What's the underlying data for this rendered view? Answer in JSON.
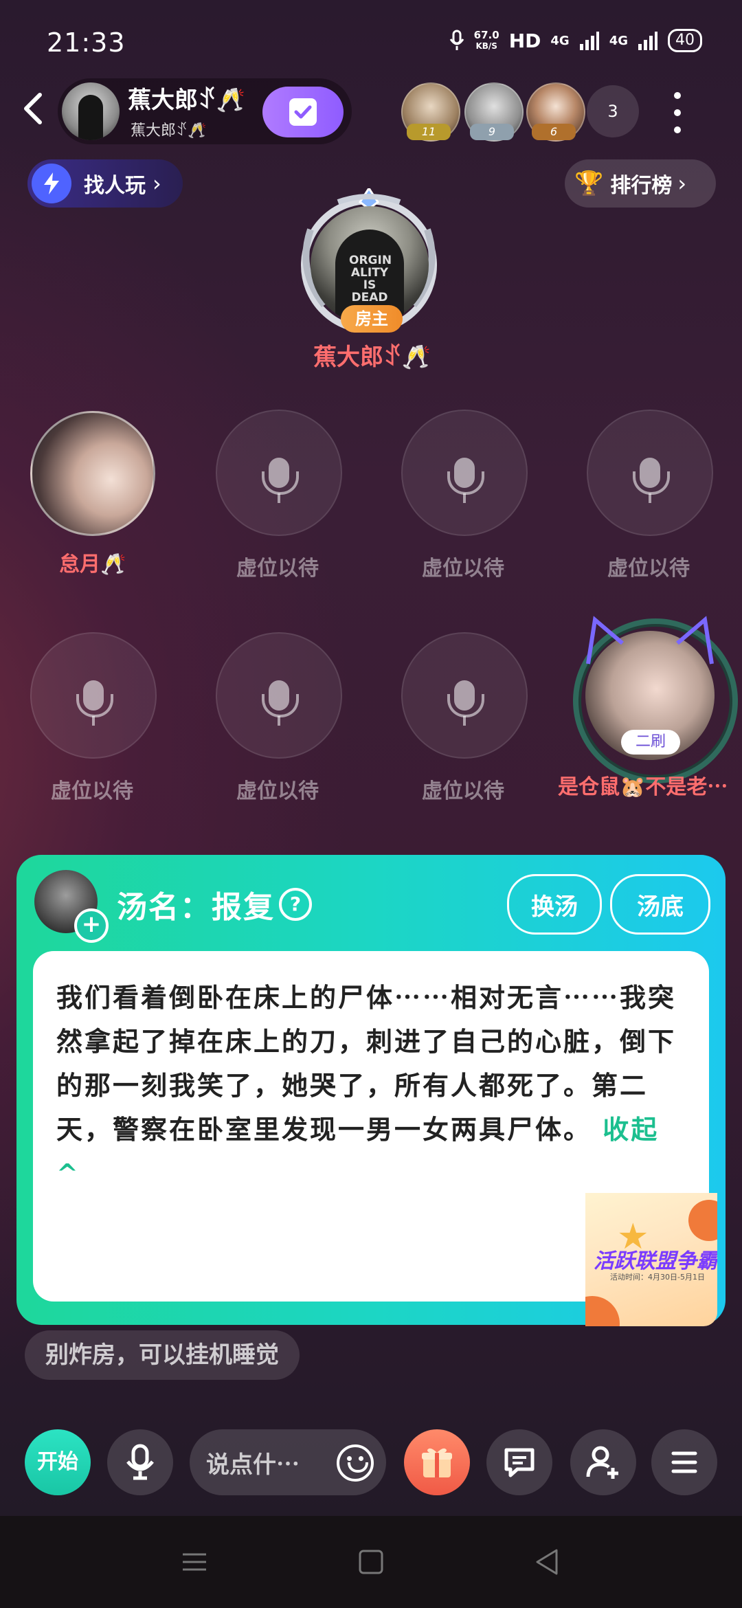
{
  "status_bar": {
    "time": "21:33",
    "net_speed": "67.0",
    "net_unit": "KB/S",
    "hd": "HD",
    "signal1": "4G",
    "signal2": "4G",
    "battery": "40"
  },
  "header": {
    "host_name": "蕉大郎ꀋ🥂",
    "host_sub": "蕉大郎ꀋ🥂",
    "audience_badges": [
      "11",
      "9",
      "6"
    ],
    "audience_count": "3"
  },
  "pills": {
    "find_label": "找人玩",
    "rank_label": "排行榜"
  },
  "host_seat": {
    "jacket_text": "ORGIN ALITY IS DEAD",
    "tag": "房主",
    "name": "蕉大郎ꀋ🥂"
  },
  "seats_row1": [
    {
      "label": "怠月🥂",
      "occupied": true
    },
    {
      "label": "虚位以待",
      "occupied": false
    },
    {
      "label": "虚位以待",
      "occupied": false
    },
    {
      "label": "虚位以待",
      "occupied": false
    }
  ],
  "seats_row2": [
    {
      "label": "虚位以待",
      "occupied": false
    },
    {
      "label": "虚位以待",
      "occupied": false
    },
    {
      "label": "虚位以待",
      "occupied": false
    },
    {
      "label": "是仓鼠🐹不是老⋯",
      "occupied": true,
      "tag": "二刷"
    }
  ],
  "card": {
    "title": "汤名：报复",
    "btn_change": "换汤",
    "btn_answer": "汤底",
    "text": "我们看着倒卧在床上的尸体⋯⋯相对无言⋯⋯我突然拿起了掉在床上的刀，刺进了自己的心脏，倒下的那一刻我笑了，她哭了，所有人都死了。第二天，警察在卧室里发现一男一女两具尸体。",
    "collapse": "收起 ^",
    "promo_title": "活跃联盟争霸",
    "promo_sub": "活动时间：4月30日-5月1日"
  },
  "hint": "别炸房，可以挂机睡觉",
  "bottom_bar": {
    "start": "开始",
    "say_placeholder": "说点什⋯"
  },
  "colors": {
    "accent_green": "#1ed79b",
    "accent_cyan": "#1cc9ee",
    "name_red": "#ff6e6e"
  }
}
